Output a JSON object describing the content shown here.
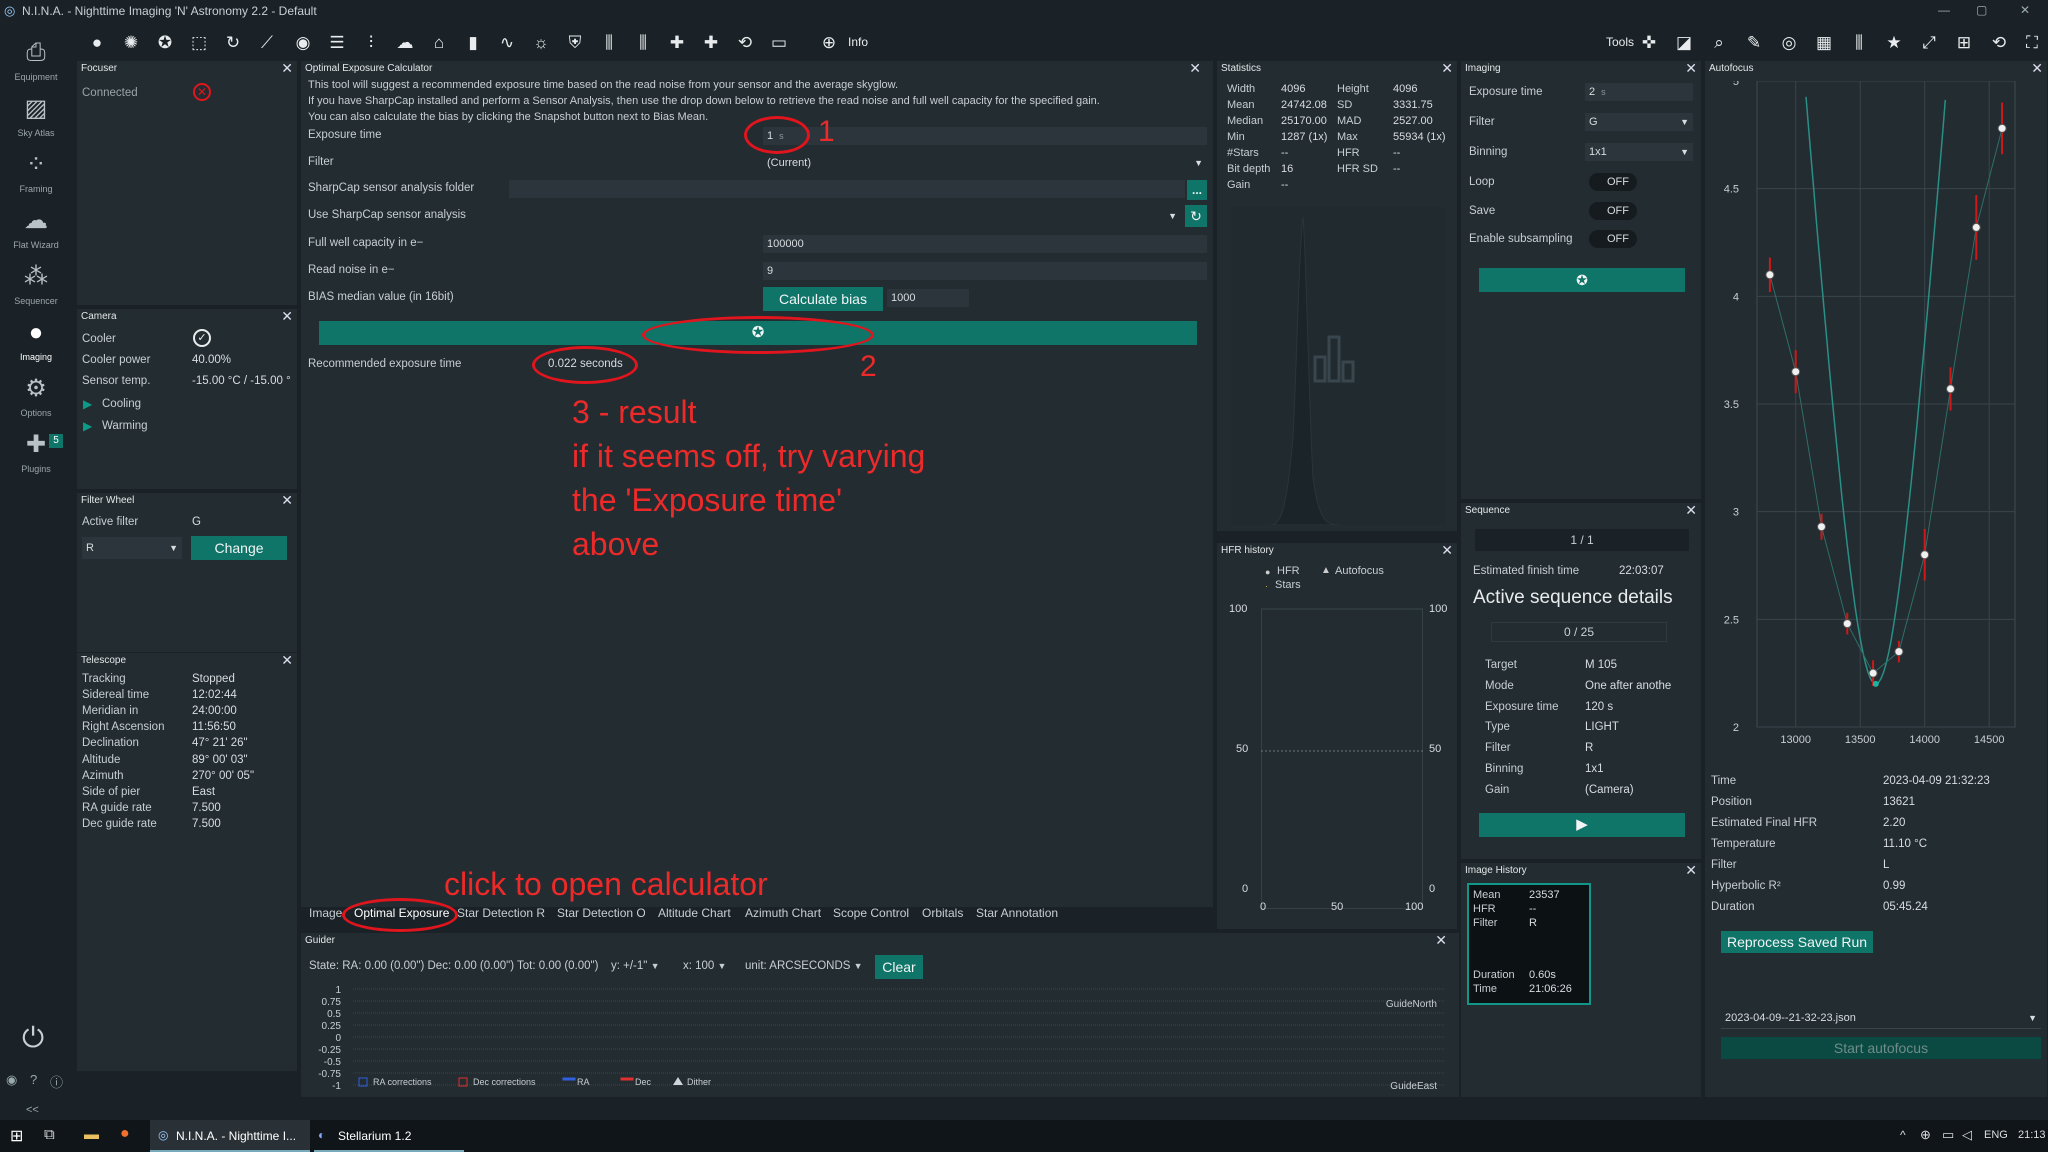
{
  "window": {
    "title": "N.I.N.A. - Nighttime Imaging 'N' Astronomy 2.2   -   Default"
  },
  "toolbar": {
    "info_label": "Info",
    "tools_label": "Tools"
  },
  "nav": [
    {
      "label": "Equipment",
      "icon": "camera-icon"
    },
    {
      "label": "Sky Atlas",
      "icon": "map-icon"
    },
    {
      "label": "Framing",
      "icon": "framing-icon"
    },
    {
      "label": "Flat Wizard",
      "icon": "wizard-icon"
    },
    {
      "label": "Sequencer",
      "icon": "sequencer-icon"
    },
    {
      "label": "Imaging",
      "icon": "aperture-icon"
    },
    {
      "label": "Options",
      "icon": "gear-icon"
    },
    {
      "label": "Plugins",
      "icon": "puzzle-icon",
      "badge": "5"
    }
  ],
  "focuser": {
    "title": "Focuser",
    "connected_label": "Connected"
  },
  "camera": {
    "title": "Camera",
    "rows": [
      {
        "label": "Cooler",
        "value": ""
      },
      {
        "label": "Cooler power",
        "value": "40.00%"
      },
      {
        "label": "Sensor temp.",
        "value": "-15.00 °C / -15.00 °"
      }
    ],
    "cooling_label": "Cooling",
    "warming_label": "Warming"
  },
  "filterwheel": {
    "title": "Filter Wheel",
    "active_label": "Active filter",
    "active_value": "G",
    "select_value": "R",
    "change_label": "Change"
  },
  "telescope": {
    "title": "Telescope",
    "rows": [
      {
        "label": "Tracking",
        "value": "Stopped"
      },
      {
        "label": "Sidereal time",
        "value": "12:02:44"
      },
      {
        "label": "Meridian in",
        "value": "24:00:00"
      },
      {
        "label": "Right Ascension",
        "value": "11:56:50"
      },
      {
        "label": "Declination",
        "value": "47° 21' 26\""
      },
      {
        "label": "Altitude",
        "value": "89° 00' 03\""
      },
      {
        "label": "Azimuth",
        "value": "270° 00' 05\""
      },
      {
        "label": "Side of pier",
        "value": "East"
      },
      {
        "label": "RA guide rate",
        "value": "7.500"
      },
      {
        "label": "Dec guide rate",
        "value": "7.500"
      }
    ]
  },
  "calc": {
    "title": "Optimal Exposure Calculator",
    "desc1": "This tool will suggest a recommended exposure time based on the read noise from your sensor and the average skyglow.",
    "desc2": "If you have SharpCap installed and perform a Sensor Analysis, then use the drop down below to retrieve the read noise and full well capacity for the specified gain.",
    "desc3": "You can also calculate the bias by clicking the Snapshot button next to Bias Mean.",
    "exposure_label": "Exposure time",
    "exposure_value": "1",
    "exposure_unit": "s",
    "filter_label": "Filter",
    "filter_value": "(Current)",
    "sharpcap_folder_label": "SharpCap sensor analysis folder",
    "sharpcap_folder_btn": "...",
    "sharpcap_use_label": "Use SharpCap sensor analysis",
    "fullwell_label": "Full well capacity in e−",
    "fullwell_value": "100000",
    "readnoise_label": "Read noise in e−",
    "readnoise_value": "9",
    "bias_label": "BIAS median value (in 16bit)",
    "bias_btn": "Calculate bias",
    "bias_value": "1000",
    "recommended_label": "Recommended exposure time",
    "recommended_value": "0.022 seconds"
  },
  "annotations": {
    "n1": "1",
    "n2": "2",
    "result_lines": [
      "3 - result",
      "if it seems off, try varying",
      "the  'Exposure time'",
      "above"
    ],
    "click_text": "click to open calculator"
  },
  "tabs": [
    "Image",
    "Optimal Exposure",
    "Star Detection Re",
    "Star Detection O",
    "Altitude Chart",
    "Azimuth Chart",
    "Scope Control",
    "Orbitals",
    "Star Annotation"
  ],
  "statistics": {
    "title": "Statistics",
    "rows": [
      {
        "l1": "Width",
        "v1": "4096",
        "l2": "Height",
        "v2": "4096"
      },
      {
        "l1": "Mean",
        "v1": "24742.08",
        "l2": "SD",
        "v2": "3331.75"
      },
      {
        "l1": "Median",
        "v1": "25170.00",
        "l2": "MAD",
        "v2": "2527.00"
      },
      {
        "l1": "Min",
        "v1": "1287 (1x)",
        "l2": "Max",
        "v2": "55934 (1x)"
      },
      {
        "l1": "#Stars",
        "v1": "--",
        "l2": "HFR",
        "v2": "--"
      },
      {
        "l1": "Bit depth",
        "v1": "16",
        "l2": "HFR SD",
        "v2": "--"
      },
      {
        "l1": "Gain",
        "v1": "--",
        "l2": "",
        "v2": ""
      }
    ]
  },
  "hfr": {
    "title": "HFR history",
    "legend_hfr": "HFR",
    "legend_autofocus": "Autofocus",
    "legend_stars": "Stars",
    "y_ticks_left": [
      "100",
      "50",
      "0"
    ],
    "y_ticks_right": [
      "100",
      "50",
      "0"
    ],
    "x_ticks": [
      "0",
      "50",
      "100"
    ]
  },
  "imaging": {
    "title": "Imaging",
    "rows": [
      {
        "label": "Exposure time",
        "value": "2",
        "unit": "s"
      },
      {
        "label": "Filter",
        "value": "G"
      },
      {
        "label": "Binning",
        "value": "1x1"
      },
      {
        "label": "Loop",
        "value": "OFF"
      },
      {
        "label": "Save",
        "value": "OFF"
      },
      {
        "label": "Enable subsampling",
        "value": "OFF"
      }
    ]
  },
  "sequence": {
    "title": "Sequence",
    "progress": "1 / 1",
    "finish_label": "Estimated finish time",
    "finish_value": "22:03:07",
    "details_title": "Active sequence details",
    "count": "0 / 25",
    "rows": [
      {
        "label": "Target",
        "value": "M 105"
      },
      {
        "label": "Mode",
        "value": "One after anothe"
      },
      {
        "label": "Exposure time",
        "value": "120 s"
      },
      {
        "label": "Type",
        "value": "LIGHT"
      },
      {
        "label": "Filter",
        "value": "R"
      },
      {
        "label": "Binning",
        "value": "1x1"
      },
      {
        "label": "Gain",
        "value": "(Camera)"
      }
    ]
  },
  "imagehistory": {
    "title": "Image History",
    "rows": [
      {
        "label": "Mean",
        "value": "23537"
      },
      {
        "label": "HFR",
        "value": "--"
      },
      {
        "label": "Filter",
        "value": "R"
      },
      {
        "label": "Duration",
        "value": "0.60s"
      },
      {
        "label": "Time",
        "value": "21:06:26"
      }
    ]
  },
  "autofocus": {
    "title": "Autofocus",
    "rows": [
      {
        "label": "Time",
        "value": "2023-04-09 21:32:23"
      },
      {
        "label": "Position",
        "value": "13621"
      },
      {
        "label": "Estimated Final HFR",
        "value": "2.20"
      },
      {
        "label": "Temperature",
        "value": "11.10 °C"
      },
      {
        "label": "Filter",
        "value": "L"
      },
      {
        "label": "Hyperbolic R²",
        "value": "0.99"
      },
      {
        "label": "Duration",
        "value": "05:45.24"
      }
    ],
    "reprocess_label": "Reprocess Saved Run",
    "saved_run": "2023-04-09--21-32-23.json",
    "start_label": "Start autofocus"
  },
  "guider": {
    "title": "Guider",
    "state": "State:  RA: 0.00 (0.00\")  Dec: 0.00 (0.00\")  Tot: 0.00 (0.00\")",
    "y_range": "y: +/-1\"",
    "x_range": "x: 100",
    "unit": "unit: ARCSECONDS",
    "clear": "Clear",
    "y_ticks": [
      "1",
      "0.75",
      "0.5",
      "0.25",
      "0",
      "-0.25",
      "-0.5",
      "-0.75",
      "-1"
    ],
    "north": "GuideNorth",
    "east": "GuideEast",
    "legend": [
      "RA corrections",
      "Dec corrections",
      "RA",
      "Dec",
      "Dither"
    ]
  },
  "taskbar": {
    "app1": "N.I.N.A. - Nighttime I...",
    "app2": "Stellarium 1.2",
    "lang": "ENG",
    "time": "21:13"
  },
  "chart_data": {
    "type": "scatter",
    "title": "",
    "xlabel": "",
    "ylabel": "",
    "xlim": [
      12700,
      14700
    ],
    "ylim": [
      2,
      5
    ],
    "x_ticks": [
      13000,
      13500,
      14000,
      14500
    ],
    "y_ticks": [
      2,
      2.5,
      3,
      3.5,
      4,
      4.5,
      5
    ],
    "series": [
      {
        "name": "",
        "points": [
          {
            "x": 12800,
            "y": 4.1,
            "err": 0.08
          },
          {
            "x": 13000,
            "y": 3.65,
            "err": 0.1
          },
          {
            "x": 13200,
            "y": 2.93,
            "err": 0.06
          },
          {
            "x": 13400,
            "y": 2.48,
            "err": 0.05
          },
          {
            "x": 13600,
            "y": 2.25,
            "err": 0.06
          },
          {
            "x": 13800,
            "y": 2.35,
            "err": 0.05
          },
          {
            "x": 14000,
            "y": 2.8,
            "err": 0.12
          },
          {
            "x": 14200,
            "y": 3.57,
            "err": 0.1
          },
          {
            "x": 14400,
            "y": 4.32,
            "err": 0.15
          },
          {
            "x": 14600,
            "y": 4.78,
            "err": 0.12
          }
        ]
      }
    ]
  }
}
